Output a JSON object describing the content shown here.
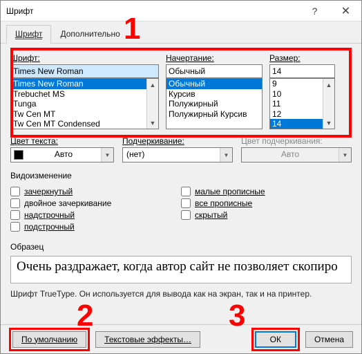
{
  "window_title": "Шрифт",
  "tabs": {
    "font": "Шрифт",
    "advanced": "Дополнительно"
  },
  "annotations": {
    "a1": "1",
    "a2": "2",
    "a3": "3"
  },
  "font_section": {
    "font_label": "Шрифт:",
    "font_value": "Times New Roman",
    "font_list": [
      "Times New Roman",
      "Trebuchet MS",
      "Tunga",
      "Tw Cen MT",
      "Tw Cen MT Condensed"
    ],
    "style_label": "Начертание:",
    "style_value": "Обычный",
    "style_list": [
      "Обычный",
      "Курсив",
      "Полужирный",
      "Полужирный Курсив"
    ],
    "size_label": "Размер:",
    "size_value": "14",
    "size_list": [
      "9",
      "10",
      "11",
      "12",
      "14"
    ]
  },
  "color_row": {
    "font_color_label": "Цвет текста:",
    "font_color_value": "Авто",
    "underline_label": "Подчеркивание:",
    "underline_value": "(нет)",
    "underline_color_label": "Цвет подчеркивания:",
    "underline_color_value": "Авто"
  },
  "effects": {
    "heading": "Видоизменение",
    "strike": "зачеркнутый",
    "dstrike": "двойное зачеркивание",
    "sup": "надстрочный",
    "sub": "подстрочный",
    "smallcaps": "малые прописные",
    "allcaps": "все прописные",
    "hidden": "скрытый"
  },
  "preview": {
    "label": "Образец",
    "text": "Очень раздражает, когда автор сайт не позволяет скопиро"
  },
  "hint": "Шрифт TrueType. Он используется для вывода как на экран, так и на принтер.",
  "buttons": {
    "default": "По умолчанию",
    "text_effects": "Текстовые эффекты…",
    "ok": "ОК",
    "cancel": "Отмена"
  }
}
